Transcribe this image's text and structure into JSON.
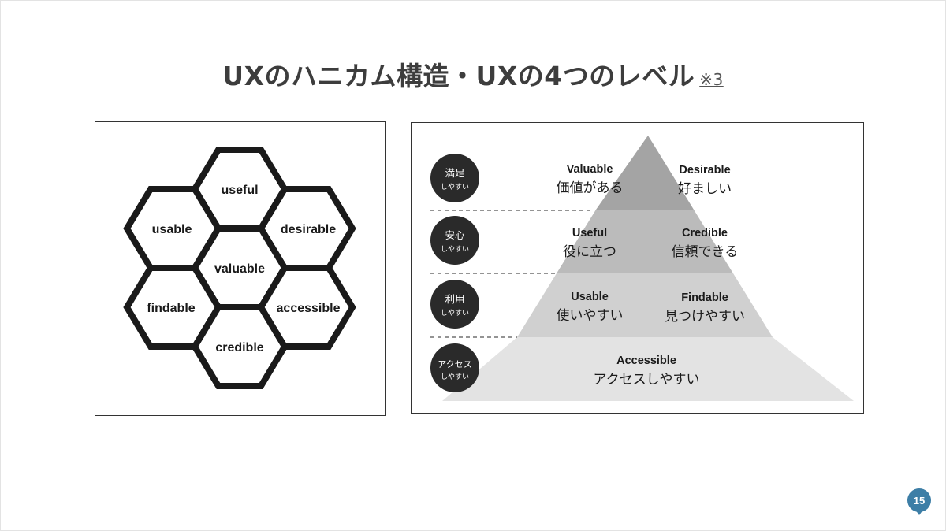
{
  "title": "UXのハニカム構造・UXの4つのレベル",
  "title_note": "※3",
  "honeycomb": {
    "cells": [
      {
        "key": "useful",
        "label": "useful"
      },
      {
        "key": "usable",
        "label": "usable"
      },
      {
        "key": "desirable",
        "label": "desirable"
      },
      {
        "key": "valuable",
        "label": "valuable"
      },
      {
        "key": "findable",
        "label": "findable"
      },
      {
        "key": "accessible",
        "label": "accessible"
      },
      {
        "key": "credible",
        "label": "credible"
      }
    ]
  },
  "pyramid": {
    "fill_colors": [
      "#a4a4a4",
      "#bbbbbb",
      "#d0d0d0",
      "#e3e3e3"
    ],
    "levels": [
      {
        "badge_top": "満足",
        "badge_sub": "しやすい",
        "items": [
          {
            "en": "Valuable",
            "ja": "価値がある"
          },
          {
            "en": "Desirable",
            "ja": "好ましい"
          }
        ]
      },
      {
        "badge_top": "安心",
        "badge_sub": "しやすい",
        "items": [
          {
            "en": "Useful",
            "ja": "役に立つ"
          },
          {
            "en": "Credible",
            "ja": "信頼できる"
          }
        ]
      },
      {
        "badge_top": "利用",
        "badge_sub": "しやすい",
        "items": [
          {
            "en": "Usable",
            "ja": "使いやすい"
          },
          {
            "en": "Findable",
            "ja": "見つけやすい"
          }
        ]
      },
      {
        "badge_top": "アクセス",
        "badge_sub": "しやすい",
        "items": [
          {
            "en": "Accessible",
            "ja": "アクセスしやすい"
          }
        ]
      }
    ]
  },
  "page_number": "15",
  "colors": {
    "badge": "#2a2a2a",
    "page_badge": "#3d7ea6",
    "hex_stroke": "#1a1a1a"
  }
}
